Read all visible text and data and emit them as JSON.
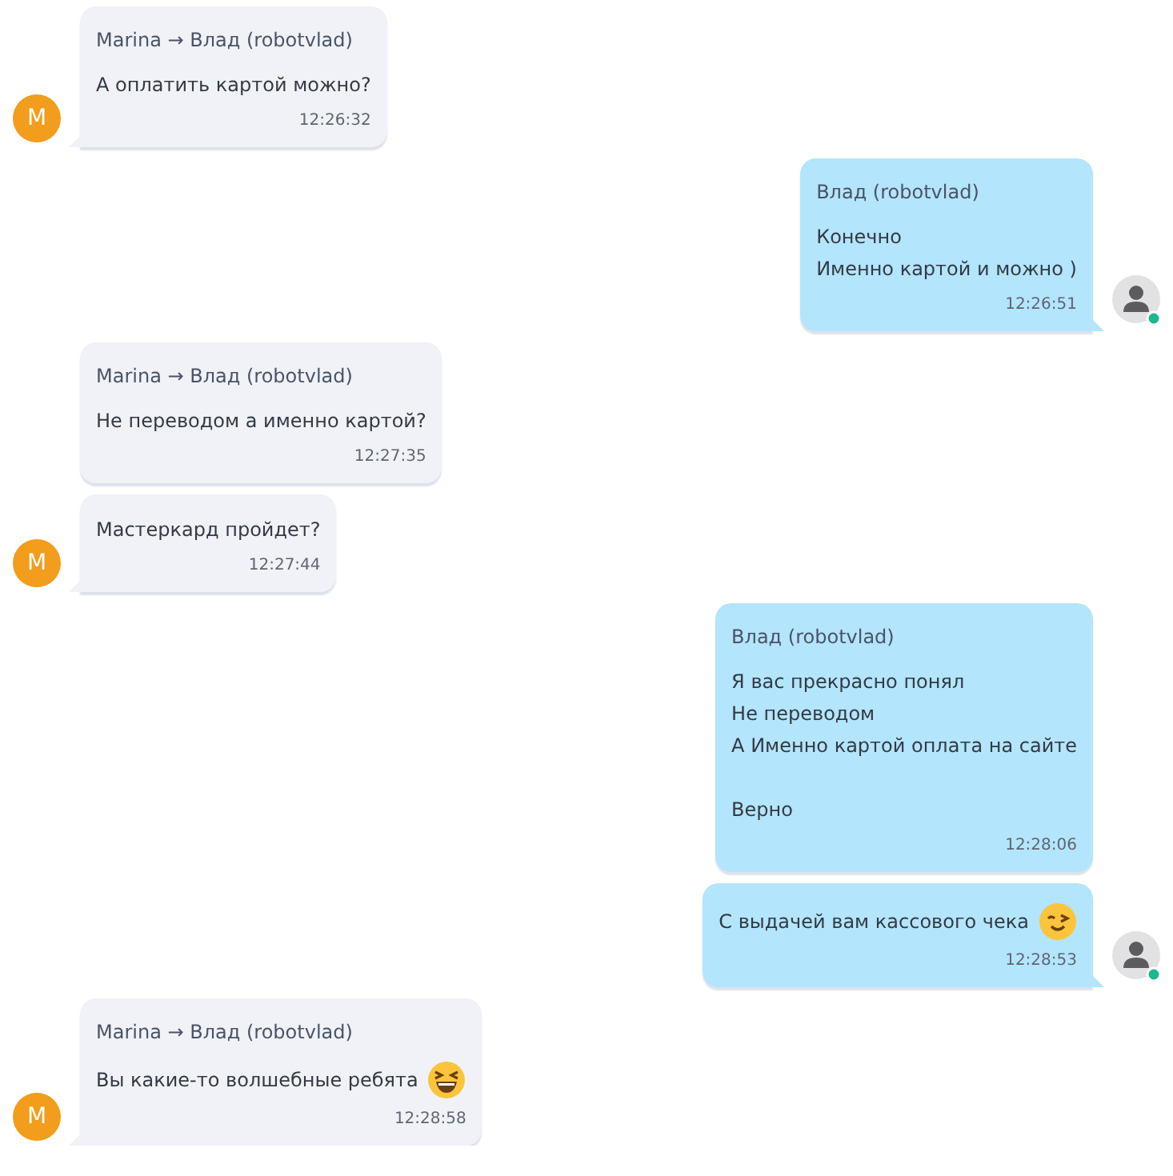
{
  "messages": [
    {
      "kind": "incoming",
      "sender": "Marina → Влад (robotvlad)",
      "paragraphs": [
        [
          "А оплатить картой можно?"
        ]
      ],
      "time": "12:26:32",
      "avatar": true,
      "initial": "M"
    },
    {
      "kind": "outgoing",
      "sender": "Влад (robotvlad)",
      "paragraphs": [
        [
          "Конечно",
          "Именно картой и можно )"
        ]
      ],
      "time": "12:26:51",
      "avatar": true,
      "online": true
    },
    {
      "kind": "incoming",
      "sender": "Marina → Влад (robotvlad)",
      "paragraphs": [
        [
          "Не переводом а именно картой?"
        ]
      ],
      "time": "12:27:35",
      "avatar": false
    },
    {
      "kind": "incoming",
      "paragraphs": [
        [
          "Мастеркард пройдет?"
        ]
      ],
      "time": "12:27:44",
      "avatar": true,
      "initial": "M"
    },
    {
      "kind": "outgoing",
      "sender": "Влад (robotvlad)",
      "paragraphs": [
        [
          "Я вас прекрасно понял",
          "Не переводом",
          "А Именно картой оплата на сайте"
        ],
        [
          "Верно"
        ]
      ],
      "time": "12:28:06",
      "avatar": false
    },
    {
      "kind": "outgoing",
      "paragraphs": [
        [
          "С выдачей вам кассового чека"
        ]
      ],
      "emoji": {
        "kind": "wink"
      },
      "time": "12:28:53",
      "avatar": true,
      "online": true
    },
    {
      "kind": "incoming",
      "sender": "Marina → Влад (robotvlad)",
      "paragraphs": [
        [
          "Вы какие-то волшебные ребята"
        ]
      ],
      "emoji": {
        "kind": "laugh"
      },
      "time": "12:28:58",
      "avatar": true,
      "initial": "M"
    }
  ]
}
